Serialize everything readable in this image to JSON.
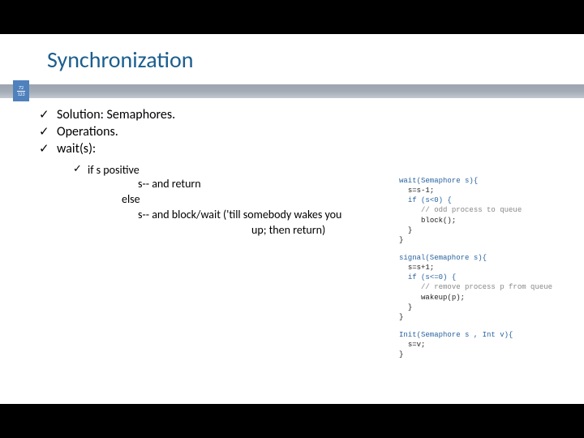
{
  "title": "Synchronization",
  "page": {
    "current": "72",
    "total": "123"
  },
  "bullets": {
    "b1": "Solution: Semaphores.",
    "b2": "Operations.",
    "b3": "wait(s):"
  },
  "sub": {
    "s1": "if s positive",
    "p1": "s-- and return",
    "p2": "else",
    "p3": "s-- and block/wait ('till somebody wakes you",
    "p4": "up; then return)"
  },
  "code": {
    "wait1": "wait(Semaphore s){",
    "wait2": "s=s-1;",
    "wait3": "if (s<0) {",
    "wait4": "// odd process to queue",
    "wait5": "block();",
    "wait6": "}",
    "wait7": "}",
    "sig1": "signal(Semaphore s){",
    "sig2": "s=s+1;",
    "sig3": "if (s<=0) {",
    "sig4": "// remove process p from queue",
    "sig5": "wakeup(p);",
    "sig6": "}",
    "sig7": "}",
    "init1": "Init(Semaphore s , Int v){",
    "init2": "s=v;",
    "init3": "}"
  }
}
